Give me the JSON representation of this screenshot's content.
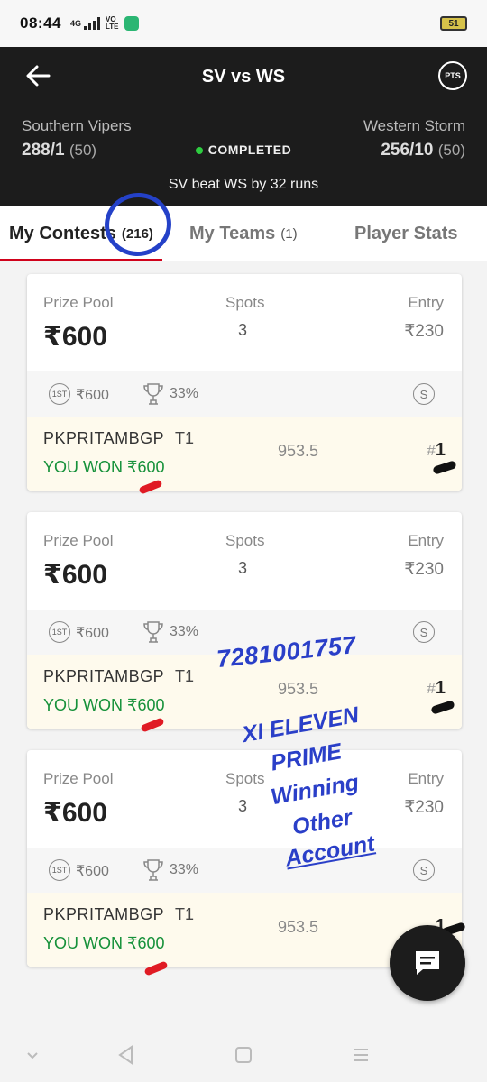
{
  "status_bar": {
    "time": "08:44",
    "network": "4G",
    "volte_top": "VO",
    "volte_bottom": "LTE",
    "battery": "51"
  },
  "header": {
    "title": "SV vs WS",
    "pts_label": "PTS",
    "team_left": {
      "name": "Southern Vipers",
      "score": "288/1",
      "overs": "(50)"
    },
    "team_right": {
      "name": "Western Storm",
      "score": "256/10",
      "overs": "(50)"
    },
    "match_status": "COMPLETED",
    "result": "SV beat WS by 32 runs"
  },
  "tabs": [
    {
      "label": "My Contests",
      "count": "(216)",
      "active": true
    },
    {
      "label": "My Teams",
      "count": "(1)",
      "active": false
    },
    {
      "label": "Player Stats",
      "count": "",
      "active": false
    }
  ],
  "card_labels": {
    "prize_pool": "Prize Pool",
    "spots": "Spots",
    "entry": "Entry",
    "first_badge": "1ST"
  },
  "contests": [
    {
      "prize": "₹600",
      "spots": "3",
      "entry": "₹230",
      "first_prize": "₹600",
      "win_pct": "33%",
      "s_badge": "S",
      "username": "PKPRITAMBGP",
      "team": "T1",
      "won": "YOU WON ₹600",
      "points": "953.5",
      "rank_prefix": "#",
      "rank": "1"
    },
    {
      "prize": "₹600",
      "spots": "3",
      "entry": "₹230",
      "first_prize": "₹600",
      "win_pct": "33%",
      "s_badge": "S",
      "username": "PKPRITAMBGP",
      "team": "T1",
      "won": "YOU WON ₹600",
      "points": "953.5",
      "rank_prefix": "#",
      "rank": "1"
    },
    {
      "prize": "₹600",
      "spots": "3",
      "entry": "₹230",
      "first_prize": "₹600",
      "win_pct": "33%",
      "s_badge": "S",
      "username": "PKPRITAMBGP",
      "team": "T1",
      "won": "YOU WON ₹600",
      "points": "953.5",
      "rank_prefix": "",
      "rank": "1"
    }
  ],
  "overlay": {
    "phone": "7281001757",
    "lines": [
      "XI ELEVEN",
      "PRIME",
      "Winning",
      "Other",
      "Account"
    ]
  },
  "colors": {
    "header_bg": "#1c1c1c",
    "accent_red": "#d0021b",
    "won_green": "#16913a",
    "overlay_blue": "#2a3fc8",
    "team_row_bg": "#fefaed"
  }
}
